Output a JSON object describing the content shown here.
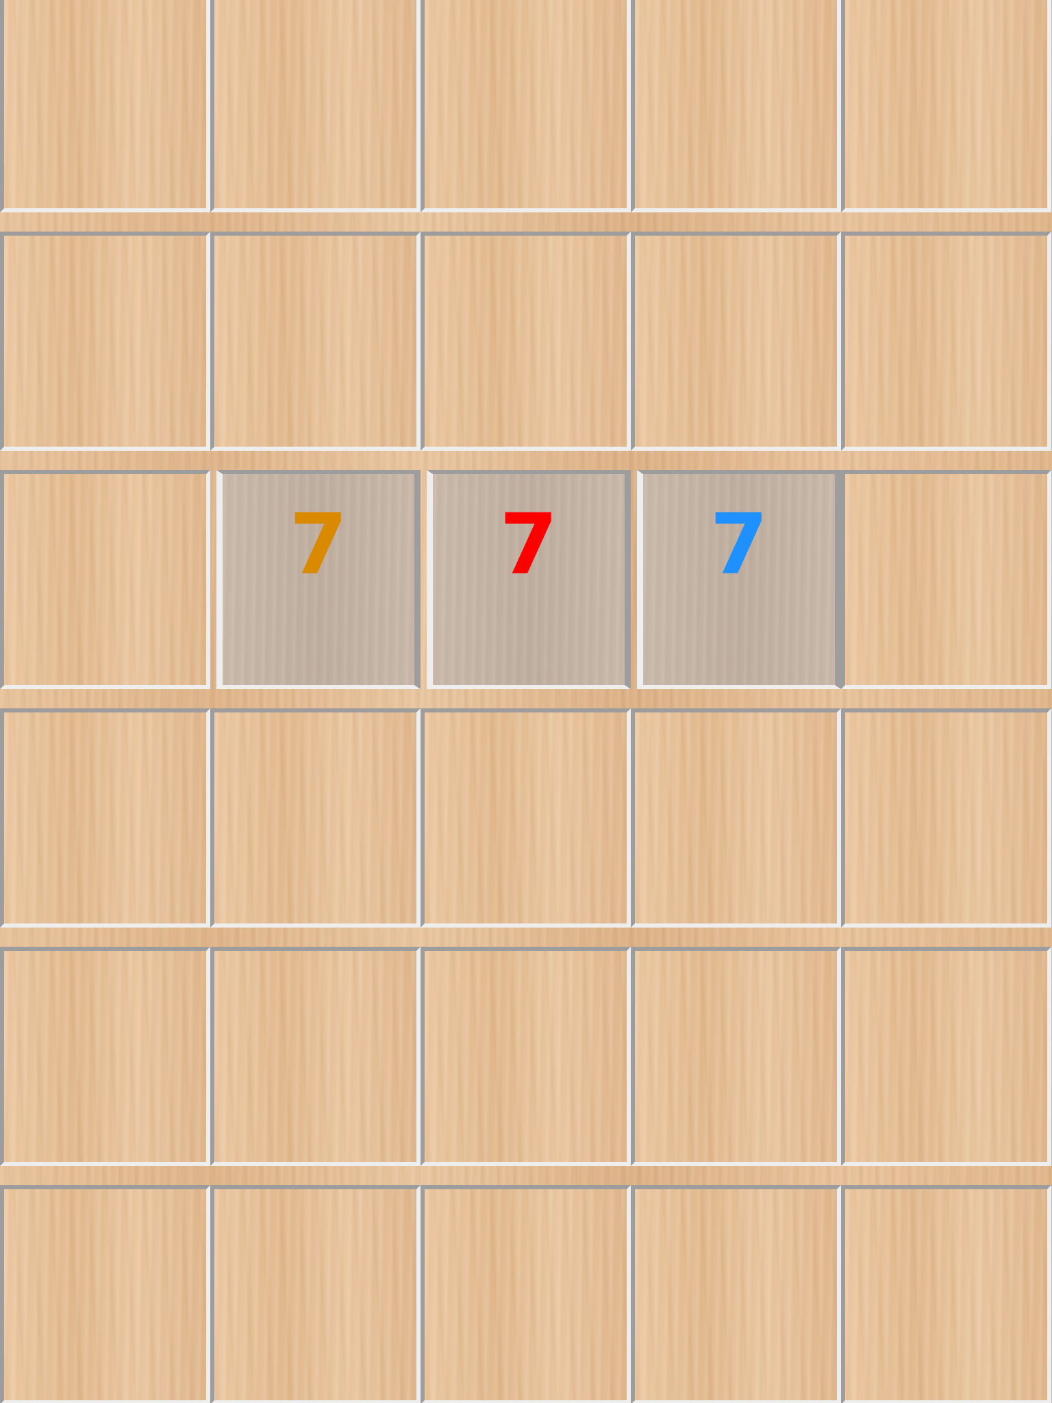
{
  "board": {
    "rows": 6,
    "cols": 5,
    "tiles": [
      {
        "row": 0,
        "col": 0,
        "value": null,
        "selected": false
      },
      {
        "row": 0,
        "col": 1,
        "value": null,
        "selected": false
      },
      {
        "row": 0,
        "col": 2,
        "value": null,
        "selected": false
      },
      {
        "row": 0,
        "col": 3,
        "value": null,
        "selected": false
      },
      {
        "row": 0,
        "col": 4,
        "value": null,
        "selected": false
      },
      {
        "row": 1,
        "col": 0,
        "value": null,
        "selected": false
      },
      {
        "row": 1,
        "col": 1,
        "value": null,
        "selected": false
      },
      {
        "row": 1,
        "col": 2,
        "value": null,
        "selected": false
      },
      {
        "row": 1,
        "col": 3,
        "value": null,
        "selected": false
      },
      {
        "row": 1,
        "col": 4,
        "value": null,
        "selected": false
      },
      {
        "row": 2,
        "col": 0,
        "value": null,
        "selected": false
      },
      {
        "row": 2,
        "col": 1,
        "value": "7",
        "color": "#d98a00",
        "selected": true
      },
      {
        "row": 2,
        "col": 2,
        "value": "7",
        "color": "#ff0000",
        "selected": true
      },
      {
        "row": 2,
        "col": 3,
        "value": "7",
        "color": "#1e90ff",
        "selected": true
      },
      {
        "row": 2,
        "col": 4,
        "value": null,
        "selected": false
      },
      {
        "row": 3,
        "col": 0,
        "value": null,
        "selected": false
      },
      {
        "row": 3,
        "col": 1,
        "value": null,
        "selected": false
      },
      {
        "row": 3,
        "col": 2,
        "value": null,
        "selected": false
      },
      {
        "row": 3,
        "col": 3,
        "value": null,
        "selected": false
      },
      {
        "row": 3,
        "col": 4,
        "value": null,
        "selected": false
      },
      {
        "row": 4,
        "col": 0,
        "value": null,
        "selected": false
      },
      {
        "row": 4,
        "col": 1,
        "value": null,
        "selected": false
      },
      {
        "row": 4,
        "col": 2,
        "value": null,
        "selected": false
      },
      {
        "row": 4,
        "col": 3,
        "value": null,
        "selected": false
      },
      {
        "row": 4,
        "col": 4,
        "value": null,
        "selected": false
      },
      {
        "row": 5,
        "col": 0,
        "value": null,
        "selected": false
      },
      {
        "row": 5,
        "col": 1,
        "value": null,
        "selected": false
      },
      {
        "row": 5,
        "col": 2,
        "value": null,
        "selected": false
      },
      {
        "row": 5,
        "col": 3,
        "value": null,
        "selected": false
      },
      {
        "row": 5,
        "col": 4,
        "value": null,
        "selected": false
      }
    ]
  }
}
